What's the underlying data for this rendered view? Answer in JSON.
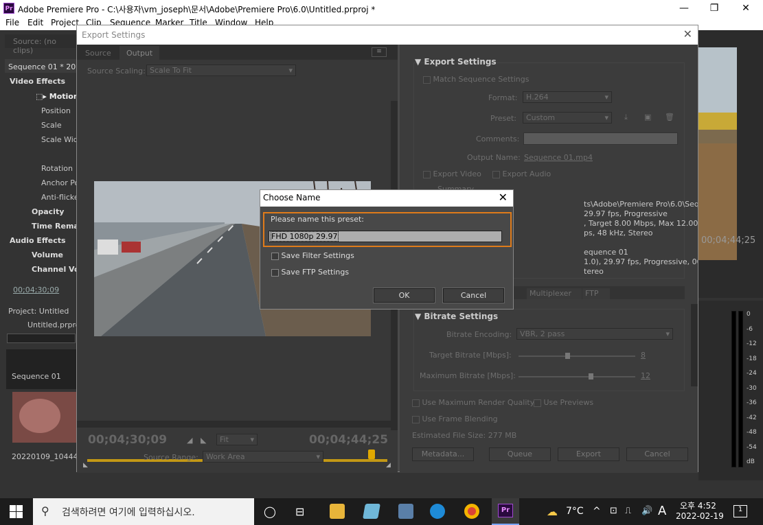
{
  "window": {
    "title": "Adobe Premiere Pro - C:\\사용자\\vm_joseph\\문서\\Adobe\\Premiere Pro\\6.0\\Untitled.prproj *",
    "logo": "Pr",
    "minimize": "—",
    "maximize": "❐",
    "close": "✕"
  },
  "menu": [
    "File",
    "Edit",
    "Project",
    "Clip",
    "Sequence",
    "Marker",
    "Title",
    "Window",
    "Help"
  ],
  "source_panel": {
    "tab": "Source: (no clips)"
  },
  "effect_controls": {
    "sequence_label": "Sequence 01 * 2022",
    "video_effects": "Video Effects",
    "motion": "Motion",
    "position": "Position",
    "scale": "Scale",
    "scale_width": "Scale Wid",
    "rotation": "Rotation",
    "anchor": "Anchor Po",
    "antiflicker": "Anti-flicke",
    "opacity": "Opacity",
    "time_remap": "Time Rema",
    "audio_effects": "Audio Effects",
    "volume": "Volume",
    "channel_volume": "Channel Vol",
    "timecode": "00;04;30;09"
  },
  "project_panel": {
    "tab": "Project: Untitled",
    "file": "Untitled.prproj",
    "sequence": "Sequence 01",
    "clip": "20220109_10444..."
  },
  "program_monitor": {
    "timecode": "00;04;44;25"
  },
  "audio_meter": {
    "labels": [
      "0",
      "-6",
      "-12",
      "-18",
      "-24",
      "-30",
      "-36",
      "-42",
      "-48",
      "-54",
      "dB"
    ]
  },
  "export_dialog": {
    "title": "Export Settings",
    "tabs": [
      "Source",
      "Output"
    ],
    "source_scaling_label": "Source Scaling:",
    "source_scaling_value": "Scale To Fit",
    "timecode_in": "00;04;30;09",
    "timecode_out": "00;04;44;25",
    "fit_value": "Fit",
    "source_range_label": "Source Range:",
    "source_range_value": "Work Area",
    "settings_heading": "Export Settings",
    "match_sequence": "Match Sequence Settings",
    "format_label": "Format:",
    "format_value": "H.264",
    "preset_label": "Preset:",
    "preset_value": "Custom",
    "comments_label": "Comments:",
    "output_name_label": "Output Name:",
    "output_name_value": "Sequence 01.mp4",
    "export_video": "Export Video",
    "export_audio": "Export Audio",
    "summary_label": "Summary",
    "summary_lines": [
      "ts\\Adobe\\Premiere Pro\\6.0\\Sequence 01.mp4",
      "29.97 fps, Progressive",
      ", Target 8.00 Mbps, Max 12.00 Mbps",
      "ps, 48 kHz, Stereo",
      "",
      "equence 01",
      "1.0), 29.97 fps, Progressive, 00;04;44;25",
      "tereo"
    ],
    "tabs2": [
      "Multiplexer",
      "FTP"
    ],
    "bitrate_heading": "Bitrate Settings",
    "bitrate_encoding_label": "Bitrate Encoding:",
    "bitrate_encoding_value": "VBR, 2 pass",
    "target_bitrate_label": "Target Bitrate [Mbps]:",
    "target_bitrate_value": "8",
    "max_bitrate_label": "Maximum Bitrate [Mbps]:",
    "max_bitrate_value": "12",
    "target_bitrate_level": 0.4,
    "max_bitrate_level": 0.6,
    "max_render_quality": "Use Maximum Render Quality",
    "use_previews": "Use Previews",
    "frame_blending": "Use Frame Blending",
    "file_size": "Estimated File Size:  277 MB",
    "buttons": {
      "metadata": "Metadata...",
      "queue": "Queue",
      "export": "Export",
      "cancel": "Cancel"
    }
  },
  "choose_name_dialog": {
    "title": "Choose Name",
    "prompt": "Please name this preset:",
    "name_value": "FHD 1080p 29.97",
    "save_filter": "Save Filter Settings",
    "save_ftp": "Save FTP Settings",
    "ok": "OK",
    "cancel": "Cancel"
  },
  "taskbar": {
    "search_placeholder": "검색하려면 여기에 입력하십시오.",
    "weather": "7°C",
    "ime": "A",
    "time": "오후 4:52",
    "date": "2022-02-19",
    "notification_count": "1"
  }
}
